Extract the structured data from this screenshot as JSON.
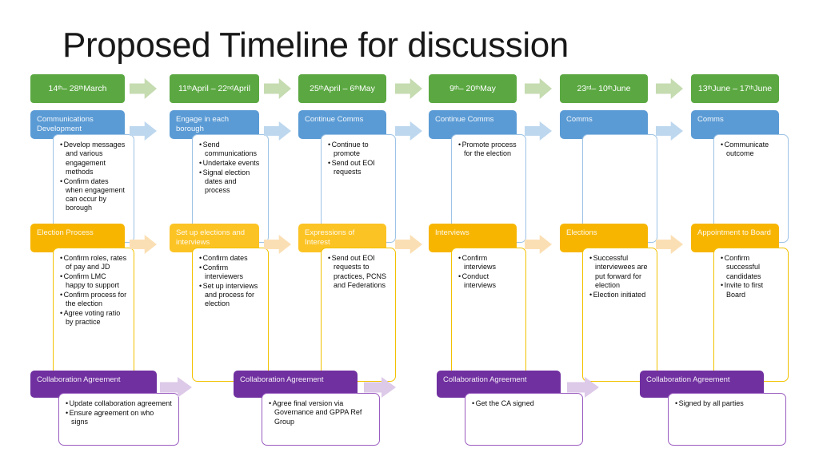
{
  "slide": {
    "title": "Proposed Timeline for discussion",
    "background": "#ffffff"
  },
  "colors": {
    "green": "#5ba842",
    "green_arrow": "#c5dbb0",
    "blue": "#5b9bd5",
    "blue_arrow": "#bdd7ee",
    "blue_border": "#9dc3e6",
    "yellow": "#f7b500",
    "yellow_arrow": "#fbdfb4",
    "yellow_border": "#f2c200",
    "purple": "#7030a0",
    "purple_arrow": "#ddc9e8",
    "purple_border": "#9a5cc0",
    "title_text": "#181818"
  },
  "timeline": {
    "name": "date-row",
    "dates": [
      {
        "prefix": "14",
        "sup1": "th",
        "mid": " – 28",
        "sup2": "th",
        "suffix": " March",
        "plain": "14th – 28th March"
      },
      {
        "prefix": "11",
        "sup1": "th",
        "mid": " April – 22",
        "sup2": "nd",
        "suffix": " April",
        "plain": "11th April – 22nd April"
      },
      {
        "prefix": "25",
        "sup1": "th",
        "mid": " April – 6",
        "sup2": "th",
        "suffix": " May",
        "plain": "25th April – 6th May"
      },
      {
        "prefix": "9",
        "sup1": "th",
        "mid": " – 20",
        "sup2": "th",
        "suffix": " May",
        "plain": "9th – 20th May"
      },
      {
        "prefix": "23",
        "sup1": "rd",
        "mid": " – 10",
        "sup2": "th",
        "suffix": " June",
        "plain": "23rd – 10th June"
      },
      {
        "prefix": "13",
        "sup1": "th",
        "mid": " June – 17",
        "sup2": "th",
        "suffix": " June",
        "plain": "13th June – 17th June"
      }
    ]
  },
  "rows": [
    {
      "name": "communications-row",
      "theme": "blue",
      "phases": [
        {
          "header": "Communications Development",
          "bullets": [
            "Develop messages and various engagement methods",
            "Confirm dates when engagement can occur by borough"
          ]
        },
        {
          "header": "Engage in each borough",
          "bullets": [
            "Send communications",
            "Undertake events",
            "Signal election dates and process"
          ]
        },
        {
          "header": "Continue Comms",
          "bullets": [
            "Continue to promote",
            "Send out EOI requests"
          ]
        },
        {
          "header": "Continue Comms",
          "bullets": [
            "Promote process for the election"
          ]
        },
        {
          "header": "Comms",
          "bullets": []
        },
        {
          "header": "Comms",
          "bullets": [
            "Communicate outcome"
          ]
        }
      ]
    },
    {
      "name": "election-process-row",
      "theme": "yellow",
      "phases": [
        {
          "header": "Election Process",
          "bullets": [
            "Confirm roles, rates of pay and JD",
            "Confirm LMC happy to support",
            "Confirm process for the election",
            "Agree voting ratio by practice"
          ]
        },
        {
          "header": "Set up elections and interviews",
          "faded": true,
          "bullets": [
            "Confirm dates",
            "Confirm interviewers",
            "Set up interviews and process for election"
          ]
        },
        {
          "header": "Expressions of Interest",
          "faded": true,
          "bullets": [
            "Send out EOI requests to practices, PCNS and Federations"
          ]
        },
        {
          "header": "Interviews",
          "bullets": [
            "Confirm interviews",
            "Conduct interviews"
          ]
        },
        {
          "header": "Elections",
          "bullets": [
            "Successful interviewees are put forward for election",
            "Election initiated"
          ]
        },
        {
          "header": "Appointment to Board",
          "bullets": [
            "Confirm successful candidates",
            "Invite to first Board"
          ]
        }
      ]
    },
    {
      "name": "collaboration-agreement-row",
      "theme": "purple",
      "phases": [
        {
          "header": "Collaboration Agreement",
          "bullets": [
            "Update collaboration agreement",
            "Ensure agreement on who signs"
          ]
        },
        {
          "header": "Collaboration Agreement",
          "bullets": [
            "Agree final version via Governance and GPPA Ref Group"
          ]
        },
        {
          "header": "Collaboration Agreement",
          "bullets": [
            "Get the CA signed"
          ]
        },
        {
          "header": "Collaboration Agreement",
          "bullets": [
            "Signed by all parties"
          ]
        }
      ]
    }
  ]
}
